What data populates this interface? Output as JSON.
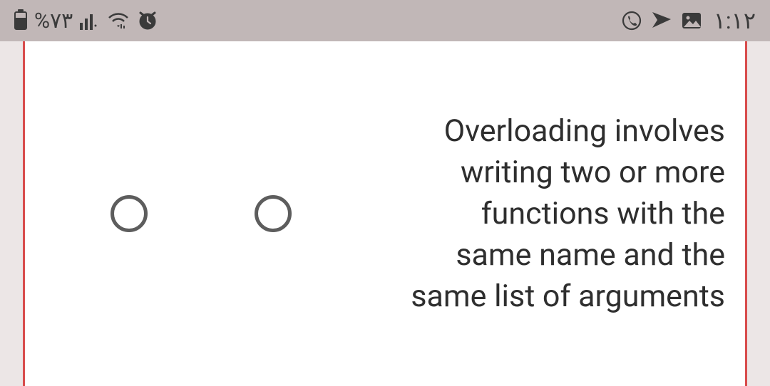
{
  "status_bar": {
    "battery_percent": "%۷۳",
    "clock": "۱:۱۲"
  },
  "question": {
    "text": "Overloading involves writing two or more functions with the same name and the same list of arguments"
  }
}
